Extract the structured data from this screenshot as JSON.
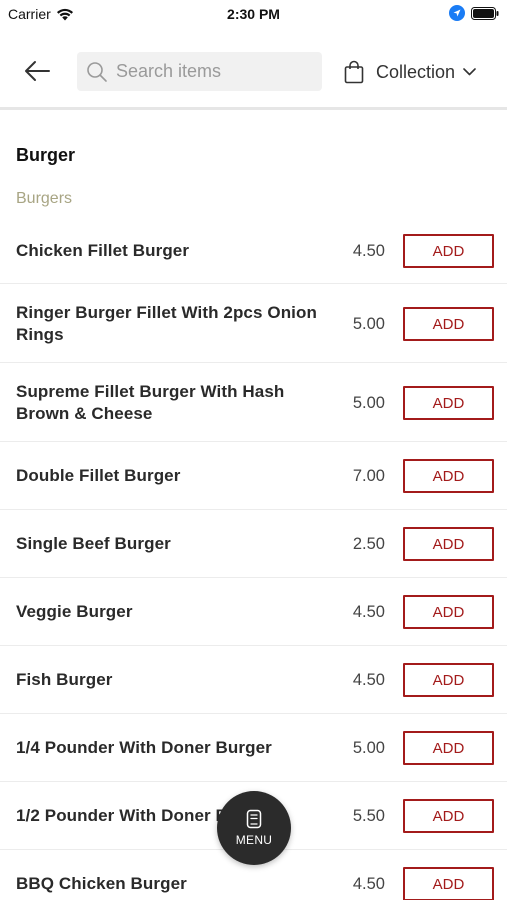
{
  "status_bar": {
    "carrier": "Carrier",
    "time": "2:30 PM"
  },
  "header": {
    "back_icon": "arrow-left-icon",
    "search": {
      "placeholder": "Search items",
      "value": ""
    },
    "collection_label": "Collection",
    "bag_icon": "shopping-bag-icon"
  },
  "menu": {
    "section_title": "Burger",
    "subsection_title": "Burgers",
    "add_label": "ADD",
    "items": [
      {
        "name": "Chicken Fillet Burger",
        "price": "4.50"
      },
      {
        "name": "Ringer Burger Fillet With 2pcs Onion Rings",
        "price": "5.00"
      },
      {
        "name": "Supreme Fillet Burger With Hash Brown & Cheese",
        "price": "5.00"
      },
      {
        "name": "Double Fillet Burger",
        "price": "7.00"
      },
      {
        "name": "Single Beef Burger",
        "price": "2.50"
      },
      {
        "name": "Veggie Burger",
        "price": "4.50"
      },
      {
        "name": "Fish Burger",
        "price": "4.50"
      },
      {
        "name": "1/4 Pounder With Doner Burger",
        "price": "5.00"
      },
      {
        "name": "1/2 Pounder With Doner Burger",
        "price": "5.50"
      },
      {
        "name": "BBQ Chicken Burger",
        "price": "4.50"
      }
    ]
  },
  "fab": {
    "label": "MENU",
    "icon": "menu-card-icon"
  },
  "colors": {
    "accent": "#a31b1b",
    "subsection": "#a8a584",
    "fab": "#2b2b2b"
  }
}
